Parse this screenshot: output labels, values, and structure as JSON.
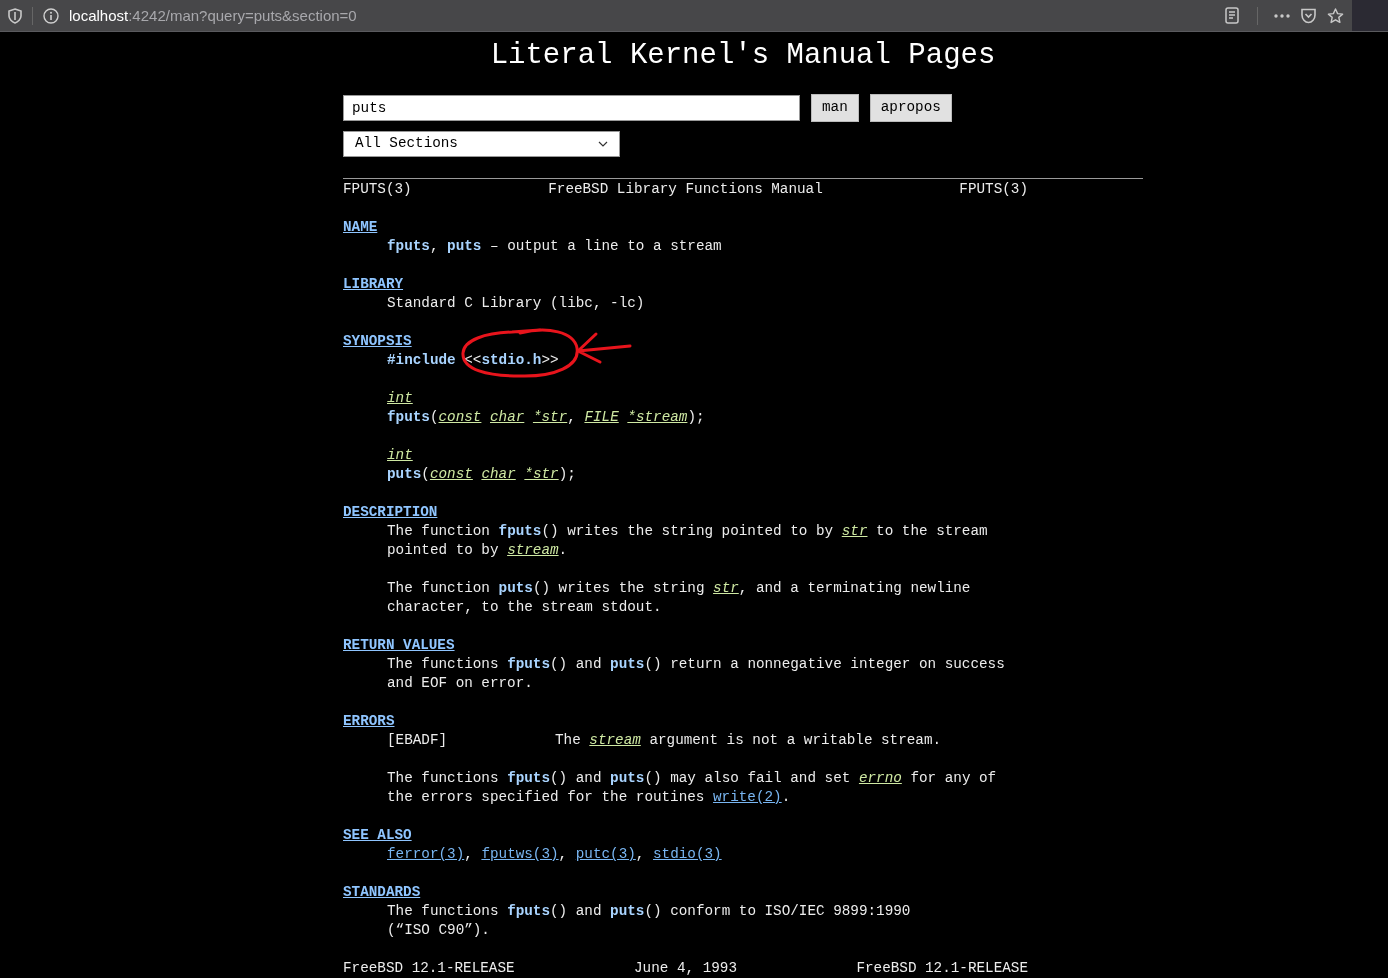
{
  "browser": {
    "url_host": "localhost",
    "url_rest": ":4242/man?query=puts&section=0"
  },
  "title": "Literal Kernel's Manual Pages",
  "search": {
    "value": "puts"
  },
  "buttons": [
    "man",
    "apropos"
  ],
  "section_select": {
    "value": "All Sections"
  },
  "header": [
    "FPUTS(3)",
    "FreeBSD Library Functions Manual",
    "FPUTS(3)"
  ],
  "sections": [
    {
      "heading": "NAME",
      "paragraphs": [
        {
          "kind": "text",
          "lines": [
            [
              {
                "kind": "b",
                "text": "fputs"
              },
              {
                "kind": "t",
                "text": ", "
              },
              {
                "kind": "b",
                "text": "puts"
              },
              {
                "kind": "t",
                "text": " – output a line to a stream"
              }
            ]
          ]
        }
      ]
    },
    {
      "heading": "LIBRARY",
      "paragraphs": [
        {
          "kind": "text",
          "lines": [
            [
              {
                "kind": "t",
                "text": "Standard C Library (libc, -lc)"
              }
            ]
          ]
        }
      ]
    },
    {
      "heading": "SYNOPSIS",
      "paragraphs": [
        {
          "kind": "text",
          "lines": [
            [
              {
                "kind": "b",
                "text": "#include"
              },
              {
                "kind": "t",
                "text": " <<"
              },
              {
                "kind": "b",
                "text": "stdio.h"
              },
              {
                "kind": "t",
                "text": ">>"
              }
            ]
          ]
        },
        {
          "kind": "text",
          "lines": [
            [
              {
                "kind": "i",
                "text": "int"
              }
            ],
            [
              {
                "kind": "b",
                "text": "fputs"
              },
              {
                "kind": "t",
                "text": "("
              },
              {
                "kind": "i",
                "text": "const char *str"
              },
              {
                "kind": "t",
                "text": ", "
              },
              {
                "kind": "i",
                "text": "FILE *stream"
              },
              {
                "kind": "t",
                "text": ");"
              }
            ]
          ]
        },
        {
          "kind": "text",
          "lines": [
            [
              {
                "kind": "i",
                "text": "int"
              }
            ],
            [
              {
                "kind": "b",
                "text": "puts"
              },
              {
                "kind": "t",
                "text": "("
              },
              {
                "kind": "i",
                "text": "const char *str"
              },
              {
                "kind": "t",
                "text": ");"
              }
            ]
          ]
        }
      ]
    },
    {
      "heading": "DESCRIPTION",
      "paragraphs": [
        {
          "kind": "text",
          "lines": [
            [
              {
                "kind": "t",
                "text": "The function "
              },
              {
                "kind": "b",
                "text": "fputs"
              },
              {
                "kind": "t",
                "text": "() writes the string pointed to by "
              },
              {
                "kind": "i",
                "text": "str"
              },
              {
                "kind": "t",
                "text": " to the stream"
              }
            ],
            [
              {
                "kind": "t",
                "text": "pointed to by "
              },
              {
                "kind": "i",
                "text": "stream"
              },
              {
                "kind": "t",
                "text": "."
              }
            ]
          ]
        },
        {
          "kind": "text",
          "lines": [
            [
              {
                "kind": "t",
                "text": "The function "
              },
              {
                "kind": "b",
                "text": "puts"
              },
              {
                "kind": "t",
                "text": "() writes the string "
              },
              {
                "kind": "i",
                "text": "str"
              },
              {
                "kind": "t",
                "text": ", and a terminating newline"
              }
            ],
            [
              {
                "kind": "t",
                "text": "character, to the stream stdout."
              }
            ]
          ]
        }
      ]
    },
    {
      "heading": "RETURN VALUES",
      "paragraphs": [
        {
          "kind": "text",
          "lines": [
            [
              {
                "kind": "t",
                "text": "The functions "
              },
              {
                "kind": "b",
                "text": "fputs"
              },
              {
                "kind": "t",
                "text": "() and "
              },
              {
                "kind": "b",
                "text": "puts"
              },
              {
                "kind": "t",
                "text": "() return a nonnegative integer on success"
              }
            ],
            [
              {
                "kind": "t",
                "text": "and EOF on error."
              }
            ]
          ]
        }
      ]
    },
    {
      "heading": "ERRORS",
      "paragraphs": [
        {
          "kind": "error",
          "tag": "[EBADF]",
          "parts": [
            {
              "kind": "t",
              "text": "The "
            },
            {
              "kind": "i",
              "text": "stream"
            },
            {
              "kind": "t",
              "text": " argument is not a writable stream."
            }
          ]
        },
        {
          "kind": "text",
          "lines": [
            [
              {
                "kind": "t",
                "text": "The functions "
              },
              {
                "kind": "b",
                "text": "fputs"
              },
              {
                "kind": "t",
                "text": "() and "
              },
              {
                "kind": "b",
                "text": "puts"
              },
              {
                "kind": "t",
                "text": "() may also fail and set "
              },
              {
                "kind": "i",
                "text": "errno"
              },
              {
                "kind": "t",
                "text": " for any of"
              }
            ],
            [
              {
                "kind": "t",
                "text": "the errors specified for the routines "
              },
              {
                "kind": "link",
                "text": "write(2)"
              },
              {
                "kind": "t",
                "text": "."
              }
            ]
          ]
        }
      ]
    },
    {
      "heading": "SEE ALSO",
      "paragraphs": [
        {
          "kind": "text",
          "lines": [
            [
              {
                "kind": "link",
                "text": "ferror(3)"
              },
              {
                "kind": "t",
                "text": ", "
              },
              {
                "kind": "link",
                "text": "fputws(3)"
              },
              {
                "kind": "t",
                "text": ", "
              },
              {
                "kind": "link",
                "text": "putc(3)"
              },
              {
                "kind": "t",
                "text": ", "
              },
              {
                "kind": "link",
                "text": "stdio(3)"
              }
            ]
          ]
        }
      ]
    },
    {
      "heading": "STANDARDS",
      "paragraphs": [
        {
          "kind": "text",
          "lines": [
            [
              {
                "kind": "t",
                "text": "The functions "
              },
              {
                "kind": "b",
                "text": "fputs"
              },
              {
                "kind": "t",
                "text": "() and "
              },
              {
                "kind": "b",
                "text": "puts"
              },
              {
                "kind": "t",
                "text": "() conform to ISO/IEC 9899:1990"
              }
            ],
            [
              {
                "kind": "t",
                "text": "(“ISO C90”)."
              }
            ]
          ]
        }
      ]
    }
  ],
  "footer": [
    "FreeBSD 12.1-RELEASE",
    "June 4, 1993",
    "FreeBSD 12.1-RELEASE"
  ]
}
